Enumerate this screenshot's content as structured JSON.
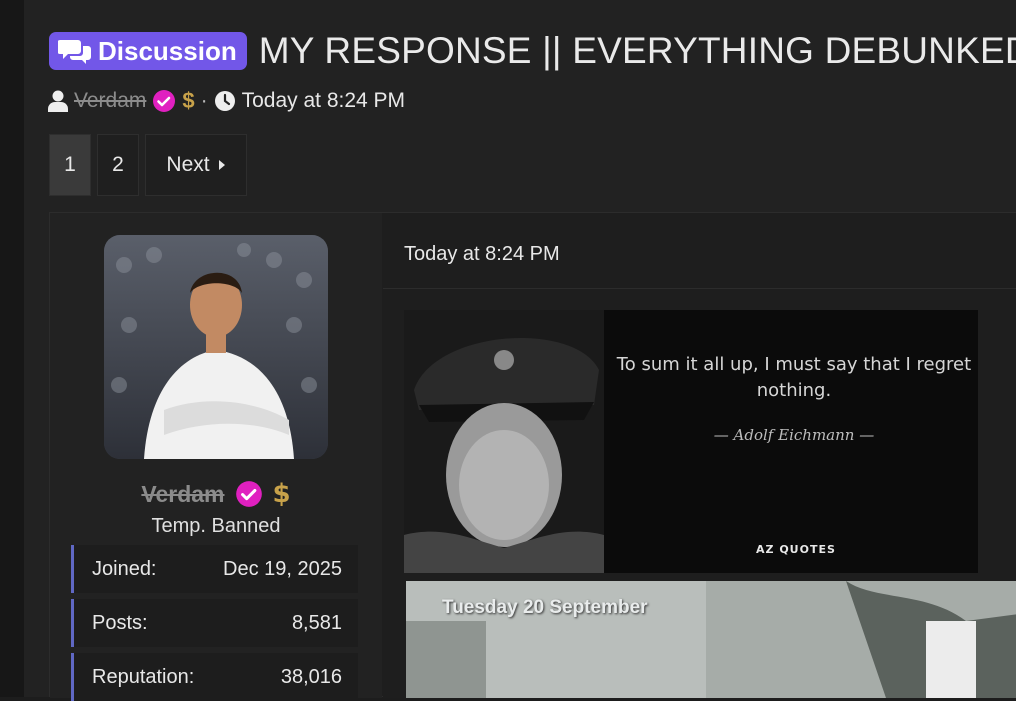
{
  "thread": {
    "prefix": "Discussion",
    "title": "MY RESPONSE || EVERYTHING DEBUNKED"
  },
  "meta": {
    "author": "Verdam",
    "dollar_badge": "$",
    "separator": "·",
    "time": "Today at 8:24 PM"
  },
  "pagination": {
    "pages": [
      "1",
      "2"
    ],
    "current": "1",
    "next_label": "Next"
  },
  "user": {
    "name": "Verdam",
    "dollar_badge": "$",
    "title": "Temp. Banned",
    "stats": [
      {
        "label": "Joined:",
        "value": "Dec 19, 2025"
      },
      {
        "label": "Posts:",
        "value": "8,581"
      },
      {
        "label": "Reputation:",
        "value": "38,016"
      }
    ]
  },
  "post": {
    "time": "Today at 8:24 PM",
    "quote_image": {
      "text": "To sum it all up, I must say that I regret nothing.",
      "author": "Adolf Eichmann",
      "brand": "AZ QUOTES"
    },
    "video_image": {
      "caption": "Tuesday 20 September"
    }
  },
  "colors": {
    "prefix_bg": "#7257e8",
    "verified": "#e020c0",
    "dollar": "#c8a24a",
    "stat_accent": "#6068c4"
  }
}
